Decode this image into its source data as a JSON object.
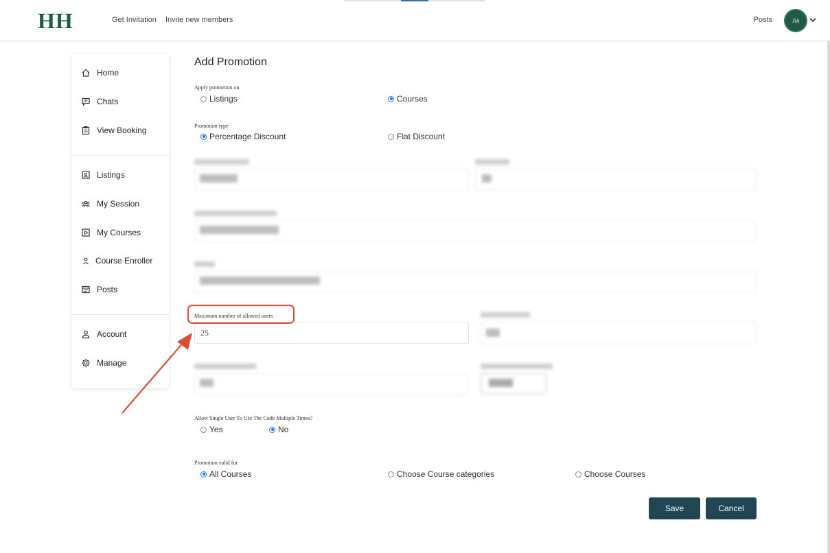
{
  "brand": {
    "logo": "HH",
    "color": "#1e5a44"
  },
  "topnav": {
    "get_invitation": "Get Invitation",
    "invite_members": "Invite new members",
    "posts": "Posts",
    "avatar_text": "Jin"
  },
  "sidebar": {
    "items": [
      {
        "label": "Home",
        "icon": "home-icon"
      },
      {
        "label": "Chats",
        "icon": "chat-icon"
      },
      {
        "label": "View Booking",
        "icon": "clipboard-icon"
      },
      {
        "label": "Listings",
        "icon": "listing-icon"
      },
      {
        "label": "My Session",
        "icon": "group-icon"
      },
      {
        "label": "My Courses",
        "icon": "play-icon"
      },
      {
        "label": "Course Enroller",
        "icon": "user-icon"
      },
      {
        "label": "Posts",
        "icon": "posts-icon"
      },
      {
        "label": "Account",
        "icon": "account-icon"
      },
      {
        "label": "Manage",
        "icon": "gear-icon"
      }
    ]
  },
  "form": {
    "title": "Add Promotion",
    "apply_on": {
      "label": "Apply promotion on",
      "options": [
        "Listings",
        "Courses"
      ],
      "selected": "Courses"
    },
    "promo_type": {
      "label": "Promotion type",
      "options": [
        "Percentage Discount",
        "Flat Discount"
      ],
      "selected": "Percentage Discount"
    },
    "max_users": {
      "label": "Maximum number of allowed users",
      "value": "25"
    },
    "multi_use": {
      "label": "Allow Single User To Use The Code Multiple Times?",
      "options": [
        "Yes",
        "No"
      ],
      "selected": "No"
    },
    "valid_for": {
      "label": "Promotion valid for",
      "options": [
        "All Courses",
        "Choose Course categories",
        "Choose Courses"
      ],
      "selected": "All Courses"
    },
    "save_label": "Save",
    "cancel_label": "Cancel"
  },
  "colors": {
    "accent": "#1a73e8",
    "button": "#1f4652",
    "highlight": "#d9503a"
  }
}
